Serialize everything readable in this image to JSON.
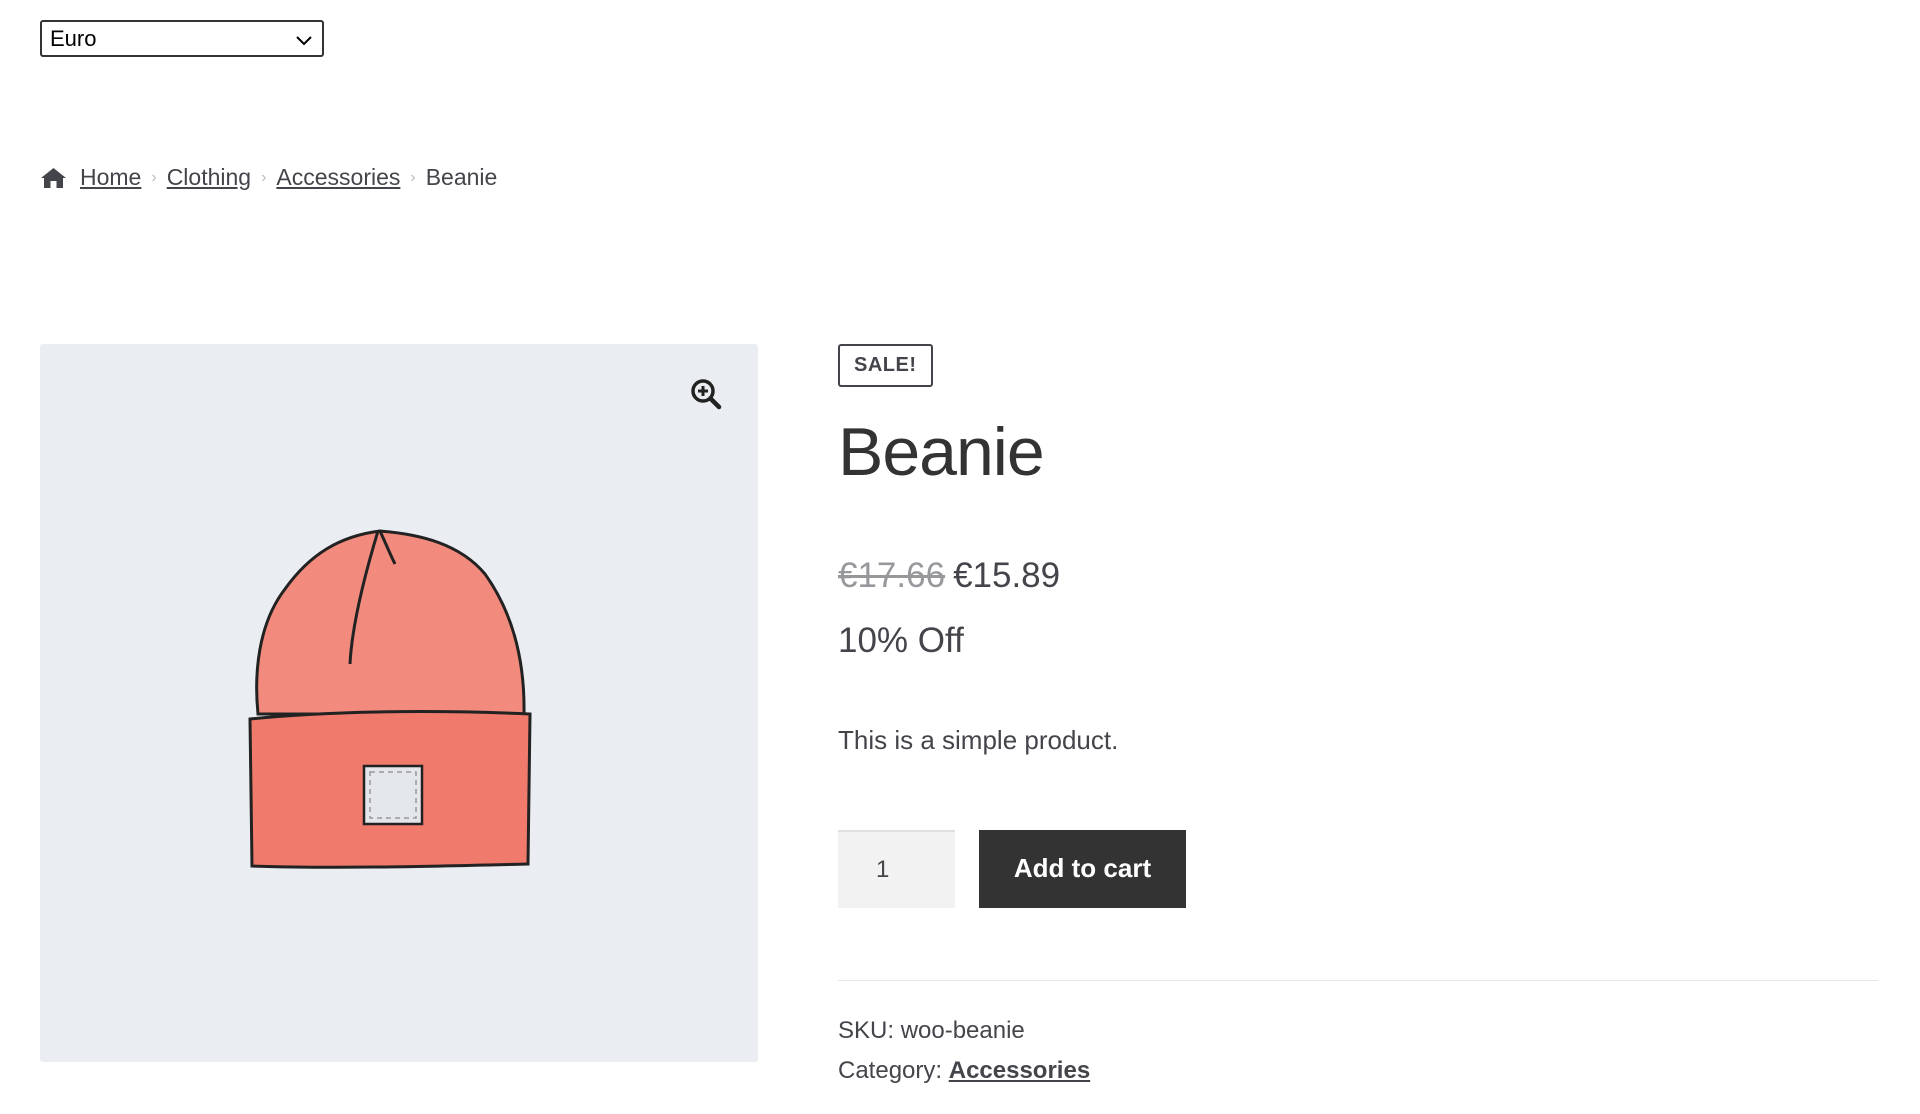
{
  "currency": {
    "selected": "Euro"
  },
  "breadcrumb": {
    "items": [
      "Home",
      "Clothing",
      "Accessories"
    ],
    "current": "Beanie"
  },
  "product": {
    "badge": "SALE!",
    "title": "Beanie",
    "old_price": "€17.66",
    "new_price": "€15.89",
    "discount": "10% Off",
    "description": "This is a simple product.",
    "quantity": "1",
    "add_to_cart_label": "Add to cart",
    "sku_label": "SKU:",
    "sku": "woo-beanie",
    "category_label": "Category:",
    "category": "Accessories"
  },
  "icons": {
    "home": "home-icon",
    "zoom": "zoom-in-icon",
    "select_arrow": "chevron-down-icon"
  },
  "colors": {
    "button_bg": "#333333",
    "gallery_bg": "#eaeef2",
    "beanie": "#f28b7d"
  }
}
